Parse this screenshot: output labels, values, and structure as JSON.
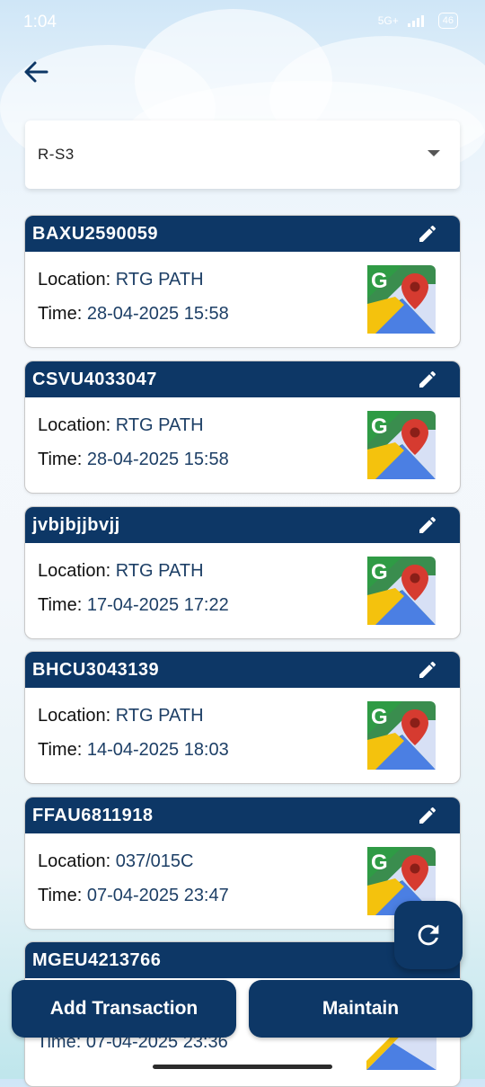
{
  "status": {
    "time": "1:04",
    "network": "5G+",
    "battery": "46"
  },
  "dropdown": {
    "selected": "R-S3"
  },
  "labels": {
    "location": "Location:",
    "time": "Time:"
  },
  "cards": [
    {
      "title": "BAXU2590059",
      "location": "RTG PATH",
      "time": "28-04-2025 15:58"
    },
    {
      "title": "CSVU4033047",
      "location": "RTG PATH",
      "time": "28-04-2025 15:58"
    },
    {
      "title": "jvbjbjjbvjj",
      "location": "RTG PATH",
      "time": "17-04-2025 17:22"
    },
    {
      "title": "BHCU3043139",
      "location": "RTG PATH",
      "time": "14-04-2025 18:03"
    },
    {
      "title": "FFAU6811918",
      "location": "037/015C",
      "time": "07-04-2025 23:47"
    },
    {
      "title": "MGEU4213766",
      "location": "",
      "time": "07-04-2025 23:36"
    }
  ],
  "buttons": {
    "add_transaction": "Add Transaction",
    "maintain": "Maintain"
  },
  "icons": {
    "back": "arrow-left-icon",
    "edit": "pencil-icon",
    "map": "google-maps-icon",
    "refresh": "refresh-icon"
  },
  "colors": {
    "primary": "#0d3766",
    "value_text": "#1d3f66"
  }
}
